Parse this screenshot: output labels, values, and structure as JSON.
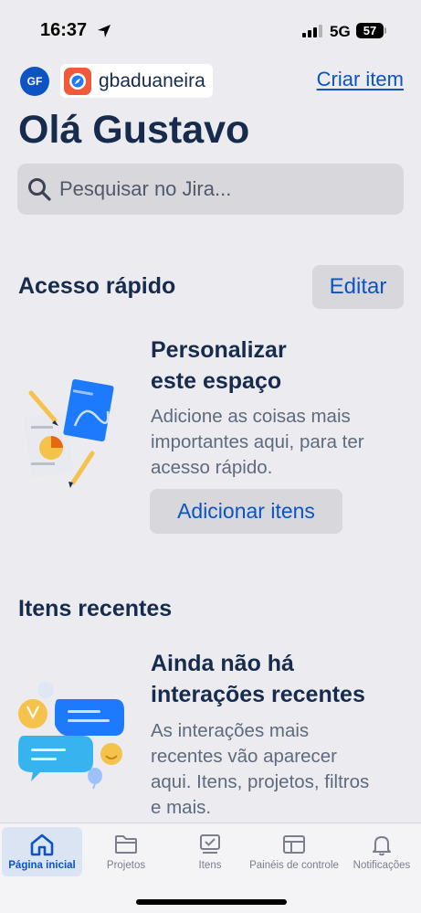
{
  "status_bar": {
    "time": "16:37",
    "network": "5G",
    "battery": "57"
  },
  "header": {
    "avatar_initials": "GF",
    "site_name": "gbaduaneira",
    "create_link": "Criar item",
    "greeting": "Olá Gustavo"
  },
  "search": {
    "placeholder": "Pesquisar no Jira..."
  },
  "quick_access": {
    "title": "Acesso rápido",
    "edit_label": "Editar",
    "card_title_line1": "Personalizar",
    "card_title_line2": "este espaço",
    "card_body_line1": "Adicione as coisas mais",
    "card_body_line2": "importantes aqui, para ter",
    "card_body_line3": "acesso rápido.",
    "add_button": "Adicionar itens"
  },
  "recent_items": {
    "title": "Itens recentes",
    "card_title_line1": "Ainda não há",
    "card_title_line2": "interações recentes",
    "card_body_line1": "As interações mais",
    "card_body_line2": "recentes vão aparecer",
    "card_body_line3": "aqui. Itens, projetos, filtros",
    "card_body_line4": "e mais."
  },
  "tab_bar": {
    "tabs": [
      {
        "label": "Página inicial",
        "icon": "home-icon",
        "active": true
      },
      {
        "label": "Projetos",
        "icon": "folder-icon",
        "active": false
      },
      {
        "label": "Itens",
        "icon": "issues-icon",
        "active": false
      },
      {
        "label": "Painéis de controle",
        "icon": "dashboard-icon",
        "active": false
      },
      {
        "label": "Notificações",
        "icon": "bell-icon",
        "active": false
      }
    ]
  },
  "colors": {
    "accent": "#0c54c4",
    "background": "#ebebf0",
    "text": "#172b4d",
    "logo": "#f05a3b"
  }
}
